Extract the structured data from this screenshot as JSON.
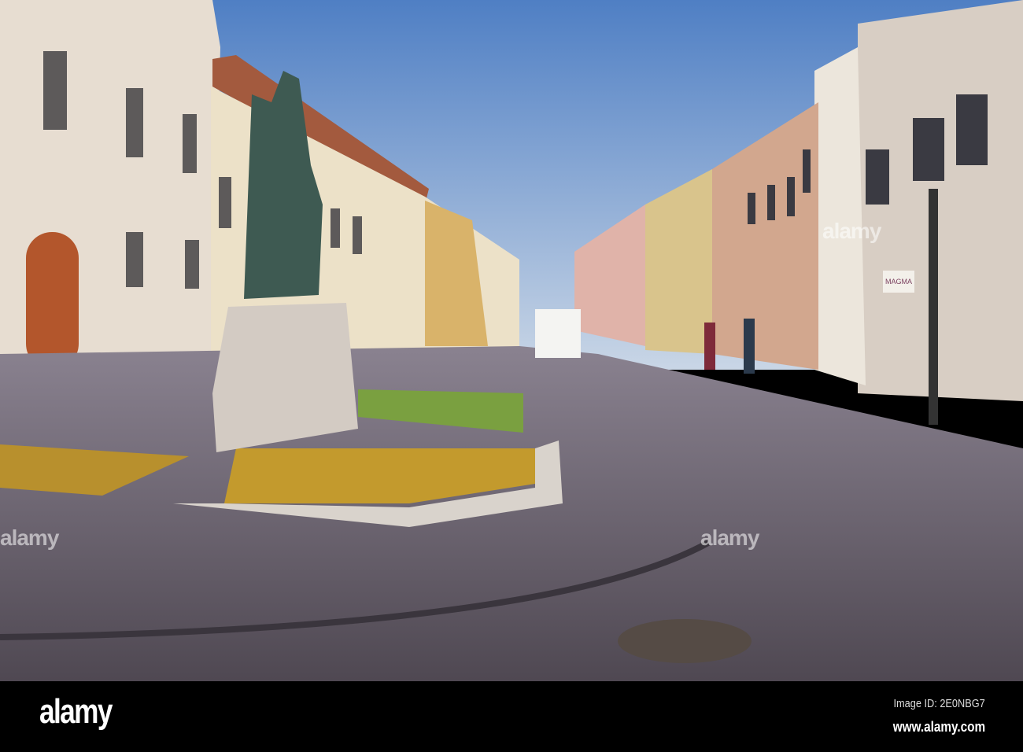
{
  "photo": {
    "subject": "Equestrian statue on a cobbled street",
    "shop_sign": "MAGMA",
    "watermark": "alamy"
  },
  "footer": {
    "logo": "alamy",
    "image_id": "Image ID: 2E0NBG7",
    "website": "www.alamy.com"
  }
}
